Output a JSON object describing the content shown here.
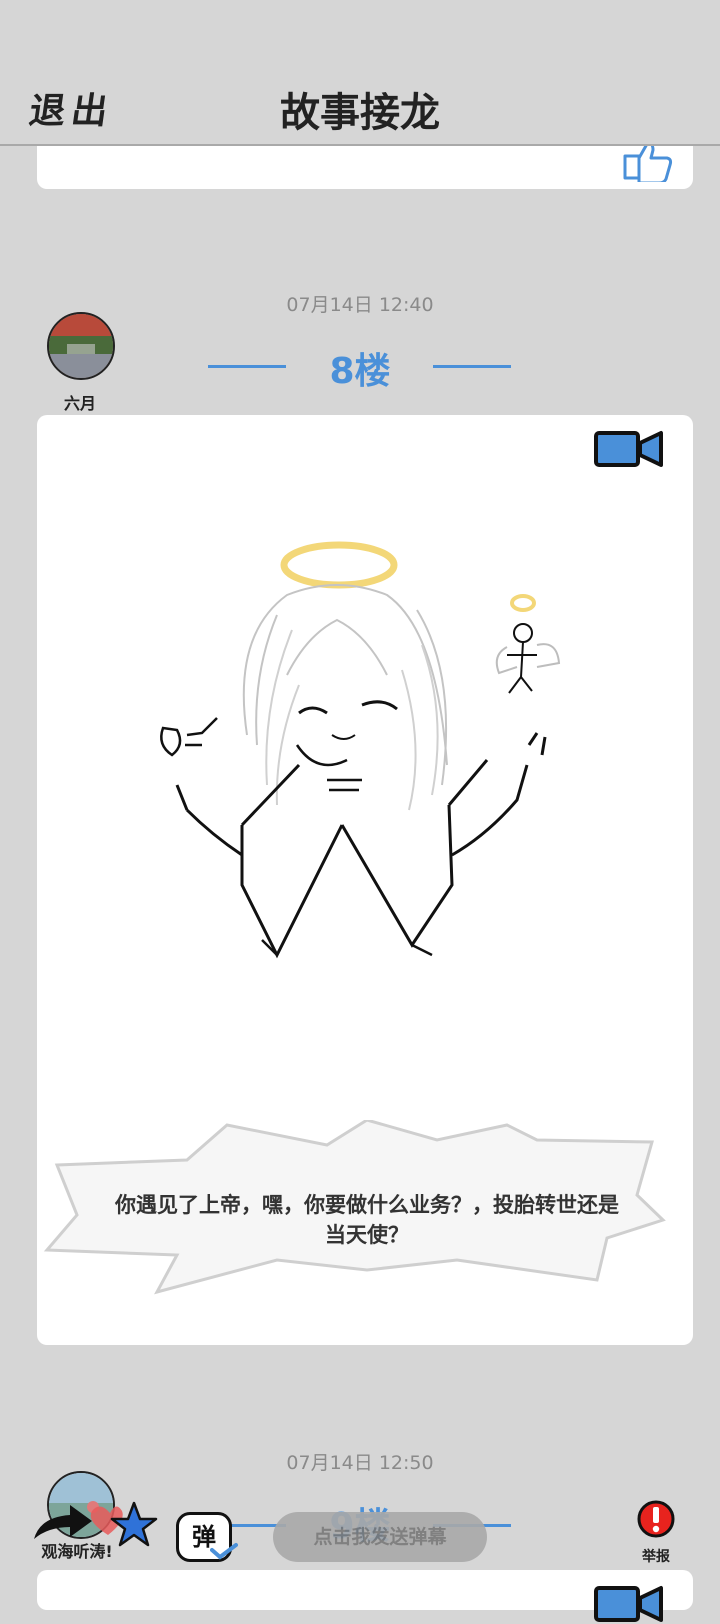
{
  "header": {
    "exit_label": "退出",
    "title": "故事接龙"
  },
  "posts": [
    {
      "time": "07月14日  12:40",
      "floor": "8楼",
      "user": "六月",
      "caption": "你遇见了上帝，嘿，你要做什么业务？，投胎转世还是当天使？"
    },
    {
      "time": "07月14日  12:50",
      "floor": "9楼",
      "user": "观海听涛!"
    }
  ],
  "bottom_bar": {
    "danmu_placeholder": "点击我发送弹幕",
    "danmu_icon_char": "弹",
    "report_label": "举报"
  },
  "colors": {
    "accent": "#4a90d9",
    "background": "#d6d6d6",
    "halo": "#f3d778",
    "report": "#e8231e"
  },
  "icons": [
    "thumbs-up-icon",
    "video-camera-icon",
    "share-icon",
    "heart-icon",
    "star-icon",
    "danmu-icon",
    "report-icon"
  ]
}
